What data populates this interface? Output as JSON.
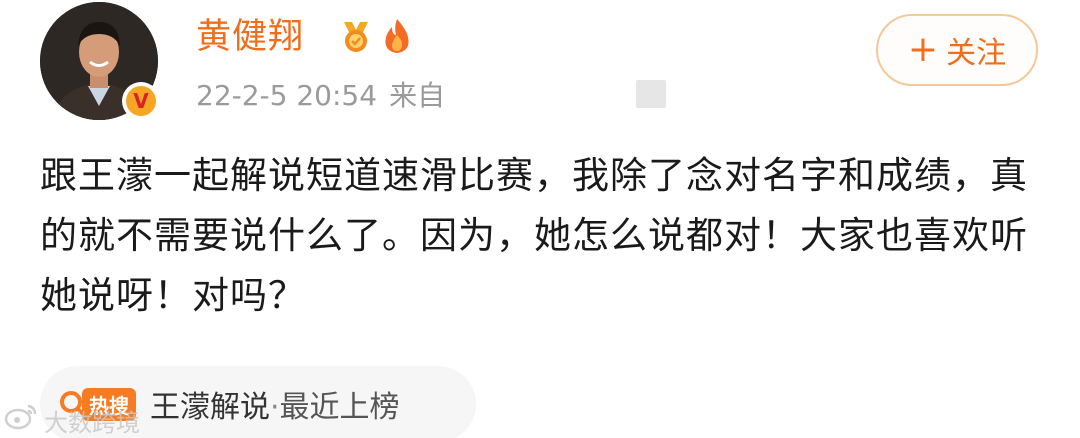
{
  "user": {
    "name": "黄健翔",
    "verified": true,
    "timestamp": "22-2-5 20:54",
    "source_prefix": "来自"
  },
  "follow_button": {
    "plus": "+",
    "label": "关注"
  },
  "post": {
    "text": "跟王濛一起解说短道速滑比赛，我除了念对名字和成绩，真的就不需要说什么了。因为，她怎么说都对！大家也喜欢听她说呀！对吗？"
  },
  "hot_search": {
    "badge": "热搜",
    "topic": "王濛解说",
    "separator": "·",
    "status": "最近上榜"
  },
  "watermark": {
    "text": "大数跨境"
  },
  "colors": {
    "brand_orange": "#f26d1b",
    "meta_gray": "#9a9a9a",
    "text_dark": "#1a1a1a",
    "tag_bg": "#f6f6f6"
  },
  "icons": {
    "verified": "verified-v-icon",
    "medal": "medal-icon",
    "fire": "fire-icon",
    "search": "search-icon",
    "watermark_logo": "weibo-logo-icon"
  }
}
